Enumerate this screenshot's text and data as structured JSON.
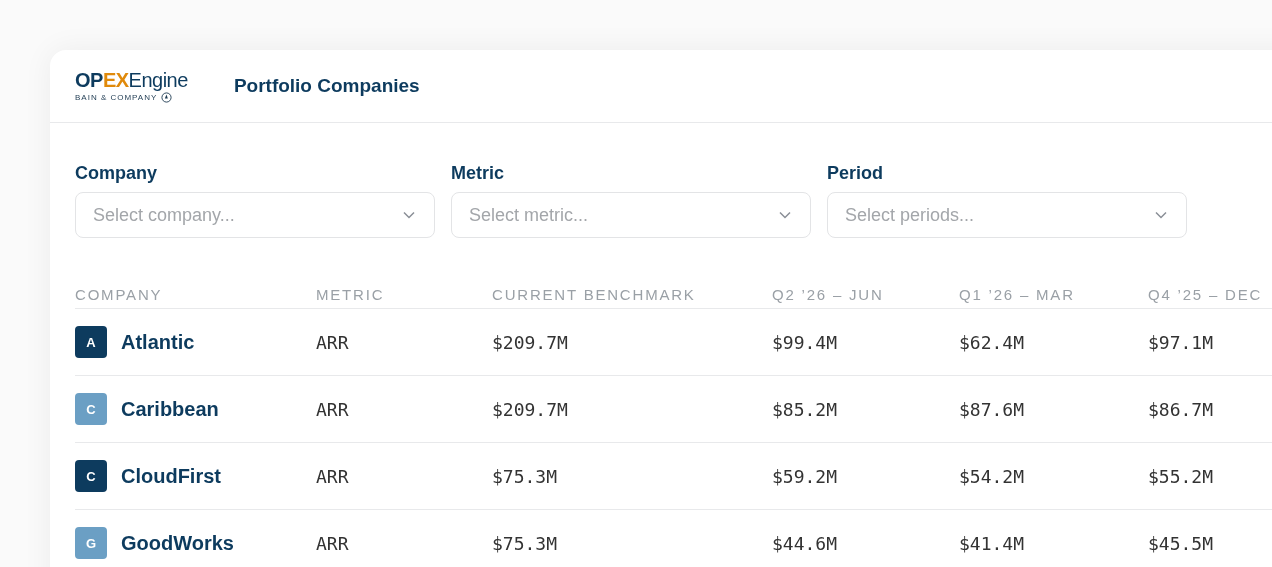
{
  "header": {
    "logo": {
      "wordmark": [
        {
          "text": "OP",
          "kind": "plain"
        },
        {
          "text": "EX",
          "kind": "accent"
        },
        {
          "text": "Engine",
          "kind": "light"
        }
      ],
      "byline": "BAIN & COMPANY"
    },
    "title": "Portfolio Companies"
  },
  "filters": [
    {
      "label": "Company",
      "placeholder": "Select company..."
    },
    {
      "label": "Metric",
      "placeholder": "Select metric..."
    },
    {
      "label": "Period",
      "placeholder": "Select periods..."
    }
  ],
  "table": {
    "columns": [
      "COMPANY",
      "METRIC",
      "CURRENT BENCHMARK",
      "Q2 ’26 – JUN",
      "Q1 ’26 – MAR",
      "Q4 ’25 – DEC"
    ],
    "rows": [
      {
        "initial": "A",
        "color": "#0d3b5e",
        "cells": [
          "Atlantic",
          "ARR",
          "$209.7M",
          "$99.4M",
          "$62.4M",
          "$97.1M"
        ]
      },
      {
        "initial": "C",
        "color": "#6b9fc4",
        "cells": [
          "Caribbean",
          "ARR",
          "$209.7M",
          "$85.2M",
          "$87.6M",
          "$86.7M"
        ]
      },
      {
        "initial": "C",
        "color": "#0d3b5e",
        "cells": [
          "CloudFirst",
          "ARR",
          "$75.3M",
          "$59.2M",
          "$54.2M",
          "$55.2M"
        ]
      },
      {
        "initial": "G",
        "color": "#6b9fc4",
        "cells": [
          "GoodWorks",
          "ARR",
          "$75.3M",
          "$44.6M",
          "$41.4M",
          "$45.5M"
        ]
      }
    ]
  }
}
